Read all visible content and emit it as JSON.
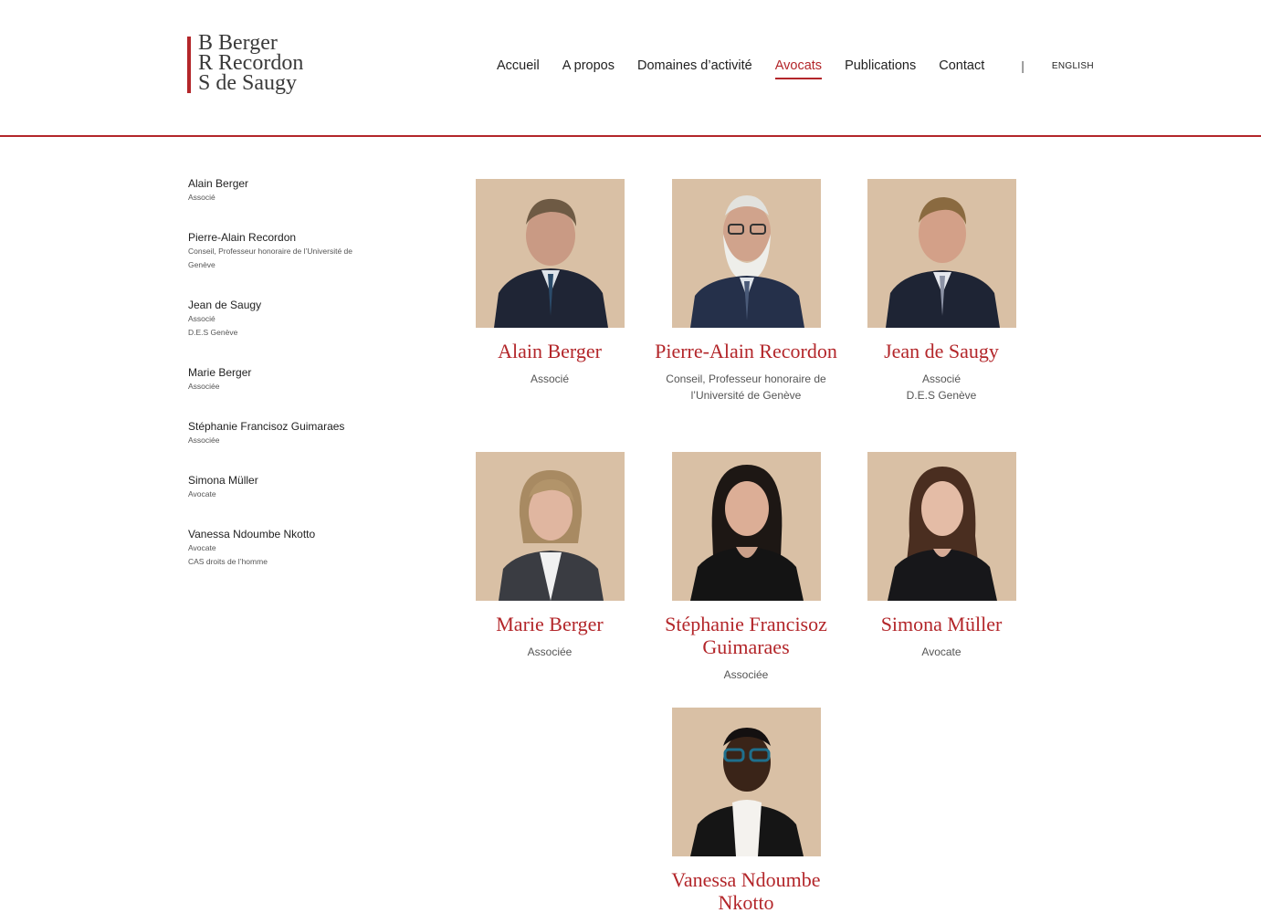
{
  "logo": {
    "line1": "B Berger",
    "line2": "R Recordon",
    "line3": "S de Saugy"
  },
  "nav": {
    "items": [
      "Accueil",
      "A propos",
      "Domaines d’activité",
      "Avocats",
      "Publications",
      "Contact"
    ],
    "active": "Avocats",
    "separator": "|",
    "language": "ENGLISH"
  },
  "colors": {
    "accent": "#b3262a",
    "photo_bg": "#d8bfa4"
  },
  "sidebar": [
    {
      "name": "Alain Berger",
      "lines": [
        "Associé"
      ]
    },
    {
      "name": "Pierre-Alain Recordon",
      "lines": [
        "Conseil, Professeur honoraire de l’Université de",
        "Genève"
      ]
    },
    {
      "name": "Jean de Saugy",
      "lines": [
        "Associé",
        "D.E.S Genève"
      ]
    },
    {
      "name": "Marie Berger",
      "lines": [
        "Associée"
      ]
    },
    {
      "name": "Stéphanie Francisoz Guimaraes",
      "lines": [
        "Associée"
      ]
    },
    {
      "name": "Simona Müller",
      "lines": [
        "Avocate"
      ]
    },
    {
      "name": "Vanessa Ndoumbe Nkotto",
      "lines": [
        "Avocate",
        "CAS droits de l’homme"
      ]
    }
  ],
  "cards": [
    {
      "name": "Alain Berger",
      "lines": [
        "Associé"
      ]
    },
    {
      "name": "Pierre-Alain Recordon",
      "lines": [
        "Conseil, Professeur honoraire de",
        "l’Université de Genève"
      ]
    },
    {
      "name": "Jean de Saugy",
      "lines": [
        "Associé",
        "D.E.S Genève"
      ]
    },
    {
      "name": "Marie Berger",
      "lines": [
        "Associée"
      ]
    },
    {
      "name": "Stéphanie Francisoz Guimaraes",
      "lines": [
        "Associée"
      ]
    },
    {
      "name": "Simona Müller",
      "lines": [
        "Avocate"
      ]
    },
    {
      "name": "Vanessa Ndoumbe Nkotto",
      "lines": []
    }
  ]
}
